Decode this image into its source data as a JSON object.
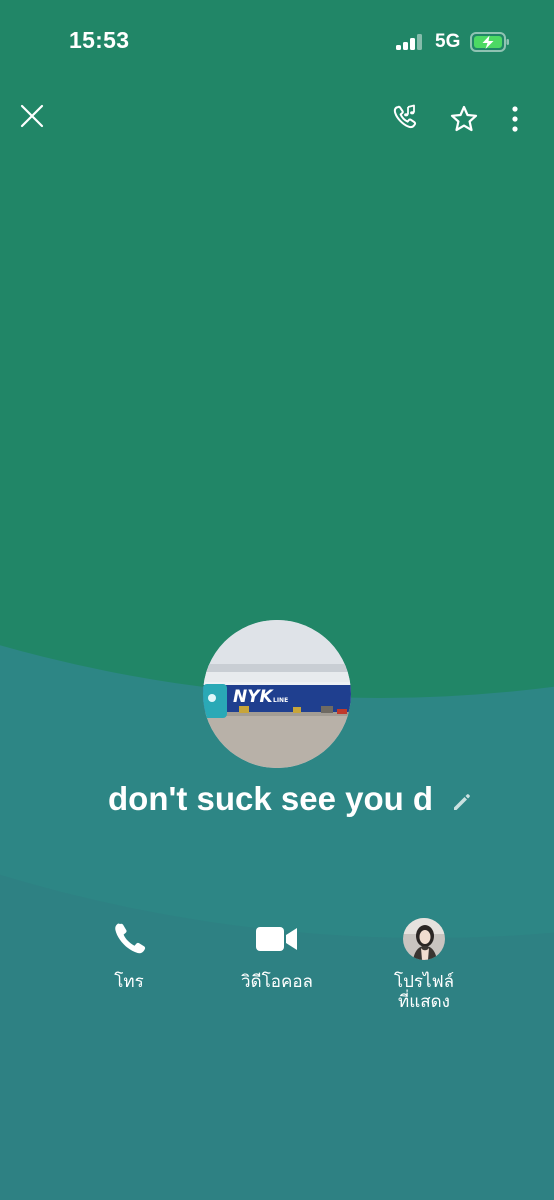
{
  "status_bar": {
    "time": "15:53",
    "network": "5G",
    "battery_charging": true,
    "battery_color": "#4cd964"
  },
  "header": {
    "close_icon": "close-icon",
    "ringtone_icon": "phone-music-icon",
    "favorite_icon": "star-icon",
    "more_icon": "more-vertical-icon"
  },
  "profile": {
    "name": "don't suck see you d",
    "avatar_description_icon": "profile-photo",
    "edit_icon": "pencil-icon"
  },
  "actions": [
    {
      "label": "โทร",
      "icon": "phone-icon"
    },
    {
      "label": "วิดีโอคอล",
      "icon": "video-camera-icon"
    },
    {
      "label": "โปรไฟล์\nที่แสดง",
      "icon": "profile-thumbnail"
    }
  ],
  "colors": {
    "background_top": "#218667",
    "background_bottom": "#2e8183",
    "text": "#ffffff"
  }
}
